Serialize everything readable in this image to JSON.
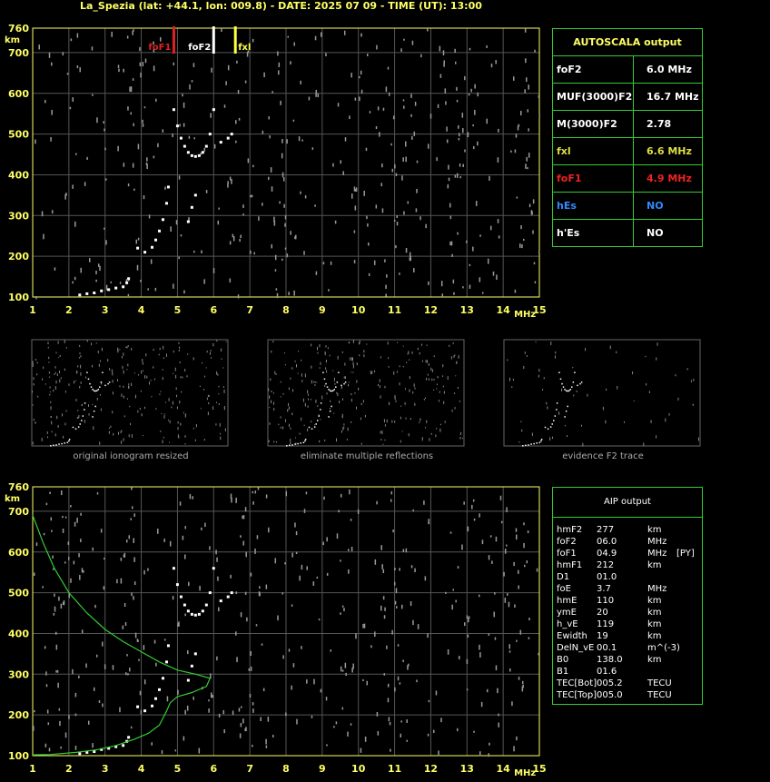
{
  "header": "La_Spezia (lat: +44.1, lon: 009.8) - DATE: 2025 07 09 - TIME (UT): 13:00",
  "axis": {
    "yunit": "km",
    "xunit": "MHz",
    "xticks": [
      "1",
      "2",
      "3",
      "4",
      "5",
      "6",
      "7",
      "8",
      "9",
      "10",
      "11",
      "12",
      "13",
      "14",
      "15"
    ],
    "yticks": [
      "760",
      "700",
      "600",
      "500",
      "400",
      "300",
      "200",
      "100"
    ]
  },
  "markers": [
    {
      "label": "foF1",
      "color": "#dd2222",
      "f": 4.9
    },
    {
      "label": "foF2",
      "color": "#ffffff",
      "f": 6.0
    },
    {
      "label": "fxl",
      "color": "#ffff44",
      "f": 6.6
    }
  ],
  "autoscala": {
    "title": "AUTOSCALA output",
    "rows": [
      {
        "k": "foF2",
        "v": "6.0 MHz",
        "color": "#ffffff"
      },
      {
        "k": "MUF(3000)F2",
        "v": "16.7 MHz",
        "color": "#ffffff"
      },
      {
        "k": "M(3000)F2",
        "v": "2.78",
        "color": "#ffffff"
      },
      {
        "k": "fxl",
        "v": "6.6 MHz",
        "color": "#dddd44"
      },
      {
        "k": "foF1",
        "v": "4.9 MHz",
        "color": "#ee2222"
      },
      {
        "k": "hEs",
        "v": "NO",
        "color": "#3388ff"
      },
      {
        "k": "h'Es",
        "v": "NO",
        "color": "#ffffff"
      }
    ]
  },
  "thumbnails": [
    "original ionogram resized",
    "eliminate multiple reflections",
    "evidence F2 trace"
  ],
  "aip": {
    "title": "AIP output",
    "rows": [
      [
        "hmF2",
        "277",
        "km",
        ""
      ],
      [
        "foF2",
        "06.0",
        "MHz",
        ""
      ],
      [
        "foF1",
        "04.9",
        "MHz",
        "[PY]"
      ],
      [
        "hmF1",
        "212",
        "km",
        ""
      ],
      [
        "D1",
        "01.0",
        "",
        ""
      ],
      [
        "foE",
        "3.7",
        "MHz",
        ""
      ],
      [
        "hmE",
        "110",
        "km",
        ""
      ],
      [
        "ymE",
        "20",
        "km",
        ""
      ],
      [
        "h_vE",
        "119",
        "km",
        ""
      ],
      [
        "Ewidth",
        "19",
        "km",
        ""
      ],
      [
        "DelN_vE",
        "00.1",
        "m^(-3)",
        ""
      ],
      [
        "B0",
        "138.0",
        "km",
        ""
      ],
      [
        "B1",
        "01.6",
        "",
        ""
      ],
      [
        "TEC[Bot]",
        "005.2",
        "TECU",
        ""
      ],
      [
        "TEC[Top]",
        "005.0",
        "TECU",
        ""
      ]
    ]
  },
  "chart_data": {
    "type": "scatter",
    "xlabel": "MHz",
    "ylabel": "km",
    "xlim": [
      1,
      15
    ],
    "ylim": [
      100,
      760
    ],
    "grid": true,
    "series": [
      {
        "color": "#ffffff",
        "points": [
          [
            2.3,
            105
          ],
          [
            2.5,
            108
          ],
          [
            2.7,
            110
          ],
          [
            2.9,
            115
          ],
          [
            3.1,
            118
          ],
          [
            3.3,
            122
          ],
          [
            3.5,
            125
          ],
          [
            3.6,
            135
          ],
          [
            3.65,
            145
          ],
          [
            3.9,
            220
          ],
          [
            4.1,
            210
          ],
          [
            4.3,
            222
          ],
          [
            4.4,
            240
          ],
          [
            4.5,
            262
          ],
          [
            4.6,
            290
          ],
          [
            4.7,
            330
          ],
          [
            4.75,
            370
          ],
          [
            4.9,
            560
          ],
          [
            5.0,
            520
          ],
          [
            5.1,
            490
          ],
          [
            5.2,
            470
          ],
          [
            5.3,
            455
          ],
          [
            5.4,
            447
          ],
          [
            5.5,
            445
          ],
          [
            5.6,
            447
          ],
          [
            5.7,
            455
          ],
          [
            5.8,
            470
          ],
          [
            5.9,
            500
          ],
          [
            6.0,
            560
          ],
          [
            6.2,
            480
          ],
          [
            6.4,
            490
          ],
          [
            6.5,
            500
          ],
          [
            5.4,
            320
          ],
          [
            5.5,
            350
          ],
          [
            5.3,
            285
          ]
        ]
      },
      {
        "color": "#33cc33",
        "points": [
          [
            1.0,
            690
          ],
          [
            1.3,
            620
          ],
          [
            1.6,
            560
          ],
          [
            2.0,
            500
          ],
          [
            2.5,
            450
          ],
          [
            3.0,
            410
          ],
          [
            3.5,
            380
          ],
          [
            4.0,
            355
          ],
          [
            4.5,
            330
          ],
          [
            5.0,
            310
          ],
          [
            5.5,
            300
          ],
          [
            5.9,
            290
          ],
          [
            5.8,
            270
          ],
          [
            5.4,
            255
          ],
          [
            5.0,
            245
          ],
          [
            4.8,
            230
          ],
          [
            4.7,
            210
          ],
          [
            4.5,
            175
          ],
          [
            4.2,
            155
          ],
          [
            3.8,
            140
          ],
          [
            3.3,
            125
          ],
          [
            2.8,
            115
          ],
          [
            2.2,
            108
          ],
          [
            1.5,
            103
          ],
          [
            1.0,
            102
          ]
        ]
      }
    ]
  }
}
